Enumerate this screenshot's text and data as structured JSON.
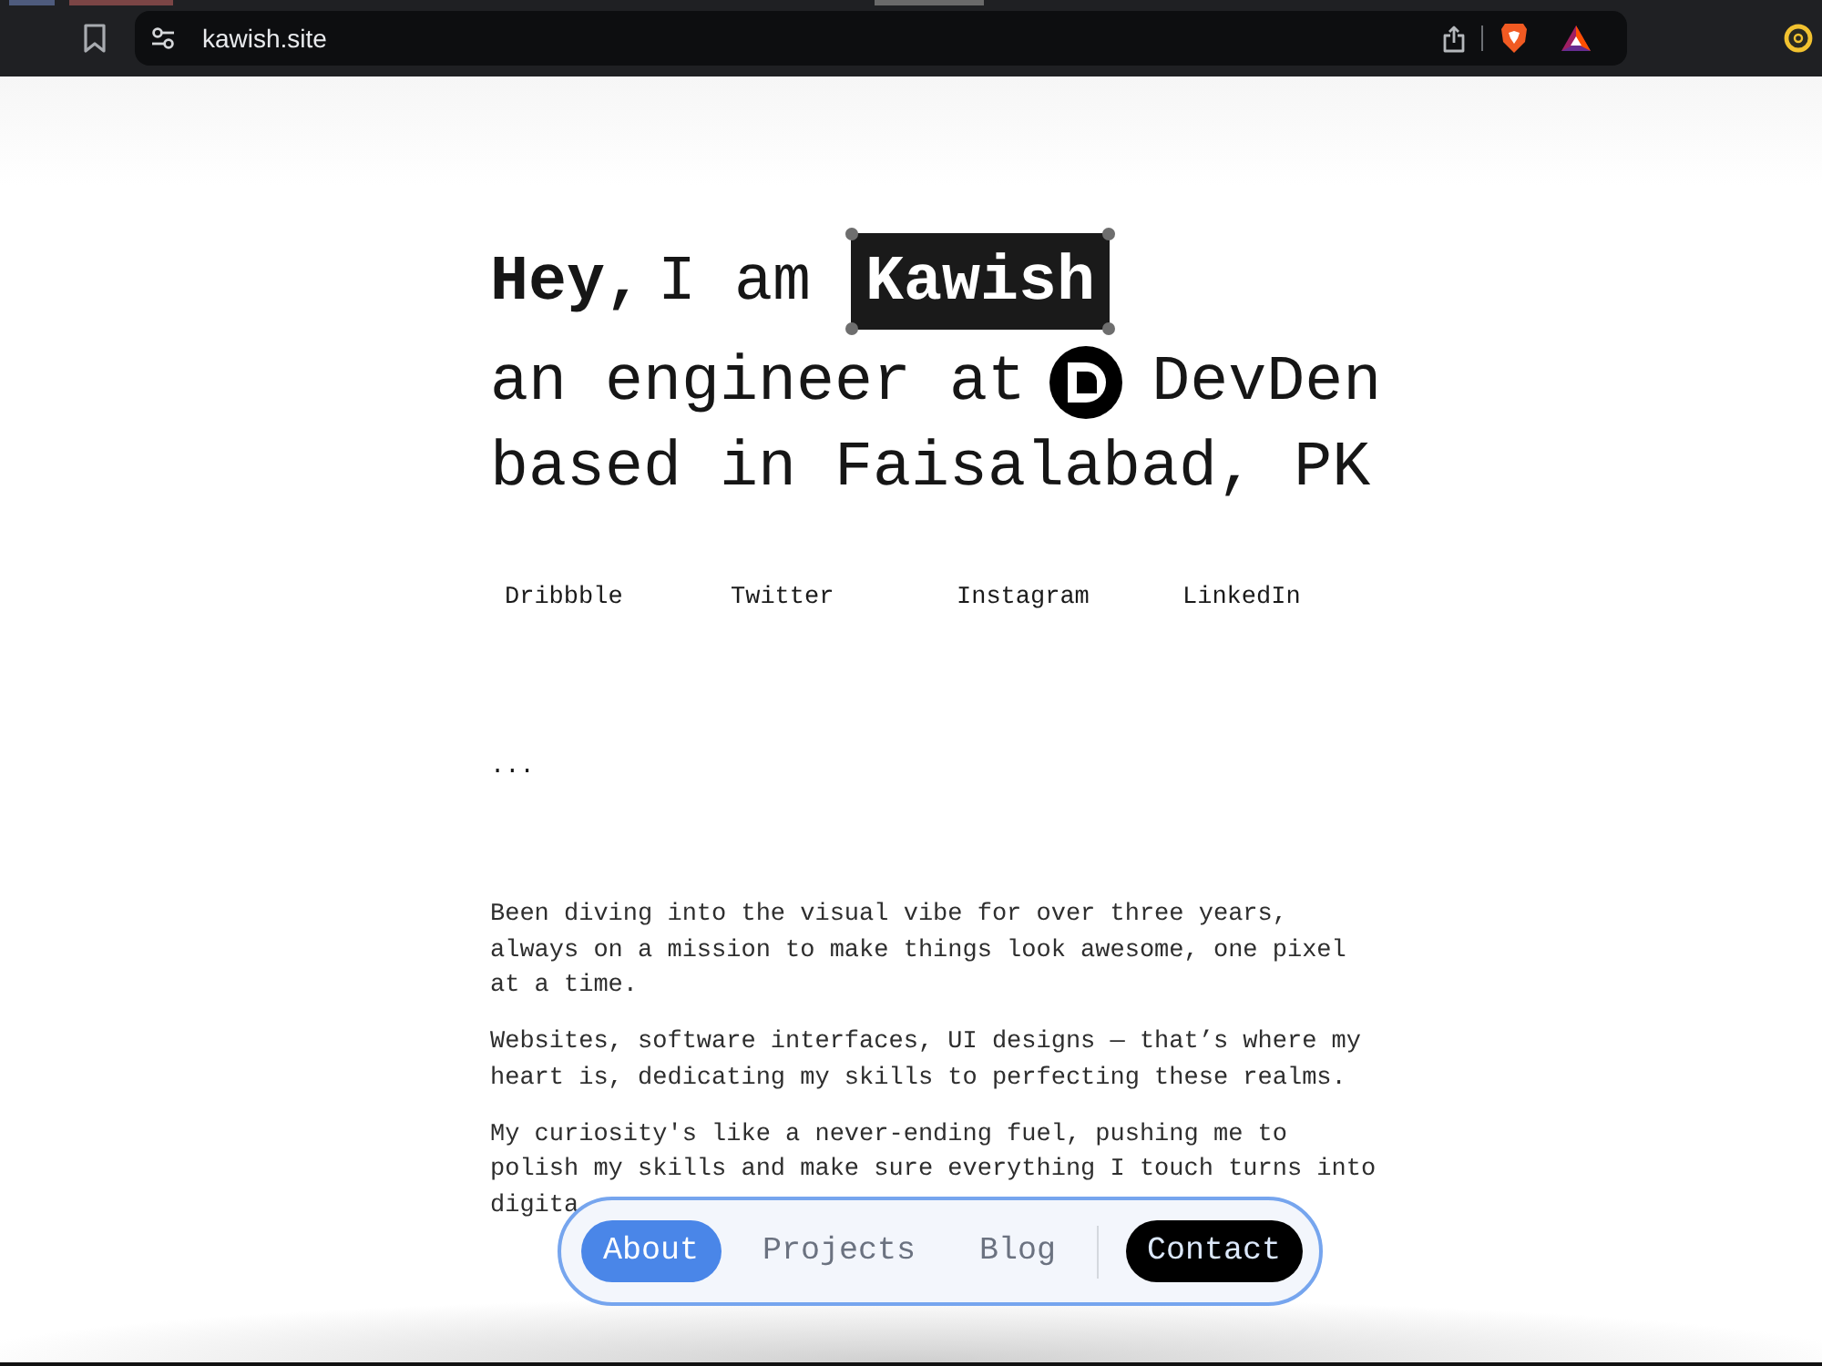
{
  "browser": {
    "url": "kawish.site"
  },
  "intro": {
    "greeting": "Hey,",
    "lead": "I am",
    "name": "Kawish",
    "role": "an engineer at",
    "company": "DevDen",
    "location": "based in Faisalabad, PK"
  },
  "socials": [
    {
      "label": "Dribbble"
    },
    {
      "label": "Twitter"
    },
    {
      "label": "Instagram"
    },
    {
      "label": "LinkedIn"
    }
  ],
  "ellipsis": "...",
  "about": [
    "Been diving into the visual vibe for over three years, always on a mission to make things look awesome, one pixel at a time.",
    "Websites, software interfaces, UI designs — that’s where my heart is, dedicating my skills to perfecting these realms.",
    "My curiosity's like a never-ending fuel, pushing me to polish my skills and make sure everything I touch turns into digita"
  ],
  "nav": {
    "items": [
      {
        "label": "About",
        "selected": true
      },
      {
        "label": "Projects",
        "selected": false
      },
      {
        "label": "Blog",
        "selected": false
      }
    ],
    "contact": {
      "label": "Contact"
    }
  }
}
